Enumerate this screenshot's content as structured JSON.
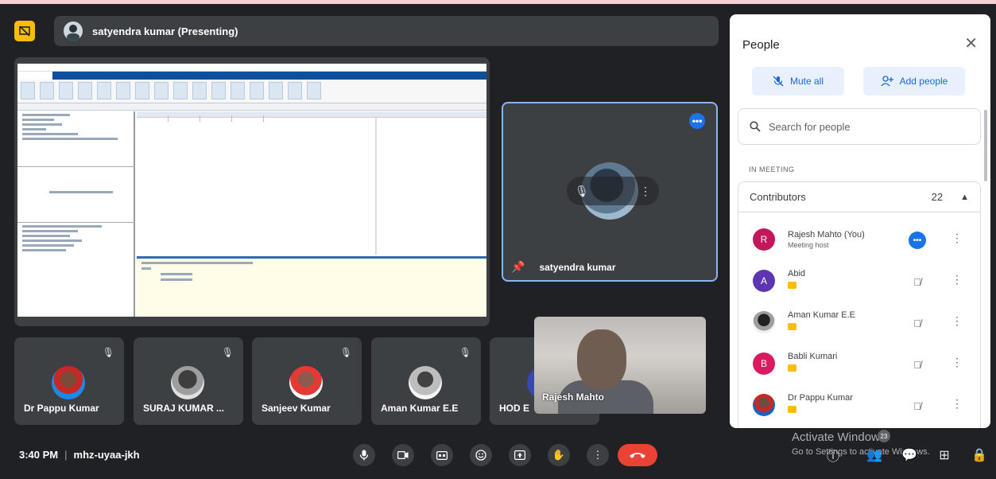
{
  "meeting": {
    "presenter_label": "satyendra kumar (Presenting)",
    "time": "3:40 PM",
    "code": "mhz-uyaa-jkh"
  },
  "featured_tile": {
    "name": "satyendra kumar"
  },
  "tiles": [
    {
      "name": "Dr Pappu Kumar"
    },
    {
      "name": "SURAJ KUMAR ..."
    },
    {
      "name": "Sanjeev Kumar"
    },
    {
      "name": "Aman Kumar E.E"
    },
    {
      "name": "HOD E"
    }
  ],
  "self_tile": {
    "name": "Rajesh Mahto"
  },
  "people_panel": {
    "title": "People",
    "mute_all_label": "Mute all",
    "add_people_label": "Add people",
    "search_placeholder": "Search for people",
    "section_label": "IN MEETING",
    "group_label": "Contributors",
    "group_count": "22",
    "participants": [
      {
        "initial": "R",
        "name": "Rajesh Mahto (You)",
        "subtitle": "Meeting host",
        "color": "#c2185b"
      },
      {
        "initial": "A",
        "name": "Abid",
        "subtitle": "",
        "color": "#5e35b1"
      },
      {
        "initial": "",
        "name": "Aman Kumar E.E",
        "subtitle": "",
        "color": "#424242"
      },
      {
        "initial": "B",
        "name": "Babli Kumari",
        "subtitle": "",
        "color": "#d81b60"
      },
      {
        "initial": "",
        "name": "Dr Pappu Kumar",
        "subtitle": "",
        "color": "#1565c0"
      }
    ]
  },
  "people_count_badge": "23",
  "watermark": {
    "line1": "Activate Windows",
    "line2": "Go to Settings to activate Windows."
  },
  "colors": {
    "background": "#202124",
    "surface": "#3c4043",
    "accent": "#1a73e8",
    "end_call": "#ea4335",
    "presenting_badge": "#fbbc04"
  }
}
